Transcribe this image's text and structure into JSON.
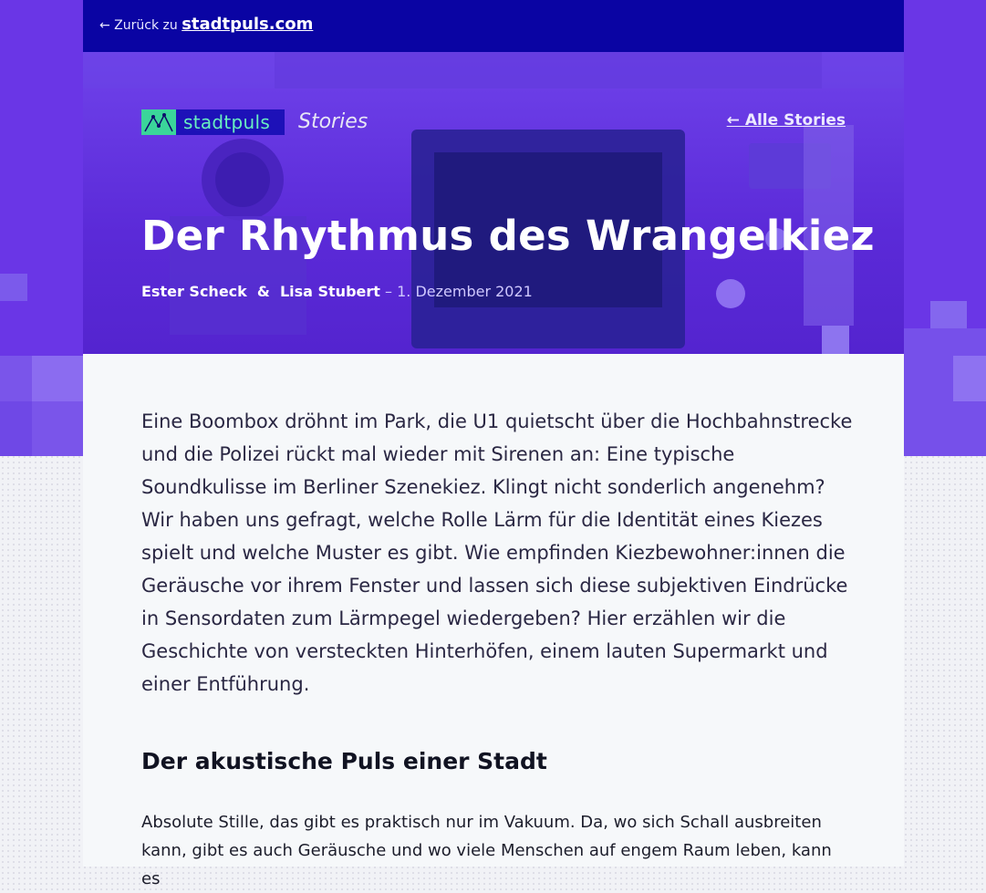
{
  "header": {
    "back_prefix": "← Zurück zu",
    "back_site": "stadtpuls.com"
  },
  "brand": {
    "logo_text": "stadtpuls",
    "section": "Stories",
    "all_stories": "← Alle Stories"
  },
  "article": {
    "title": "Der Rhythmus des Wrangelkiez",
    "author1": "Ester Scheck",
    "amp": "&",
    "author2": "Lisa Stubert",
    "date": "– 1. Dezember 2021",
    "intro": "Eine Boombox dröhnt im Park, die U1 quietscht über die Hochbahnstrecke und die Polizei rückt mal wieder mit Sirenen an: Eine typische Soundkulisse im Berliner Szenekiez. Klingt nicht sonderlich angenehm? Wir haben uns gefragt, welche Rolle Lärm für die Identität eines Kiezes spielt und welche Muster es gibt. Wie empfinden Kiezbewohner:innen die Geräusche vor ihrem Fenster und lassen sich diese subjektiven Eindrücke in Sensordaten zum Lärmpegel wiedergeben? Hier erzählen wir die Geschichte von versteckten Hinterhöfen, einem lauten Supermarkt und einer Entführung.",
    "section_heading": "Der akustische Puls einer Stadt",
    "section_text": "Absolute Stille, das gibt es praktisch nur im Vakuum. Da, wo sich Schall ausbreiten kann, gibt es auch Geräusche und wo viele Menschen auf engem Raum leben, kann es"
  },
  "colors": {
    "hero_purple": "#6a36e6",
    "top_bar": "#0a04a3",
    "logo_green": "#3bd59a"
  },
  "icons": {
    "logo": "stadtpuls-logo-icon",
    "hero": "circuit-board-image"
  }
}
